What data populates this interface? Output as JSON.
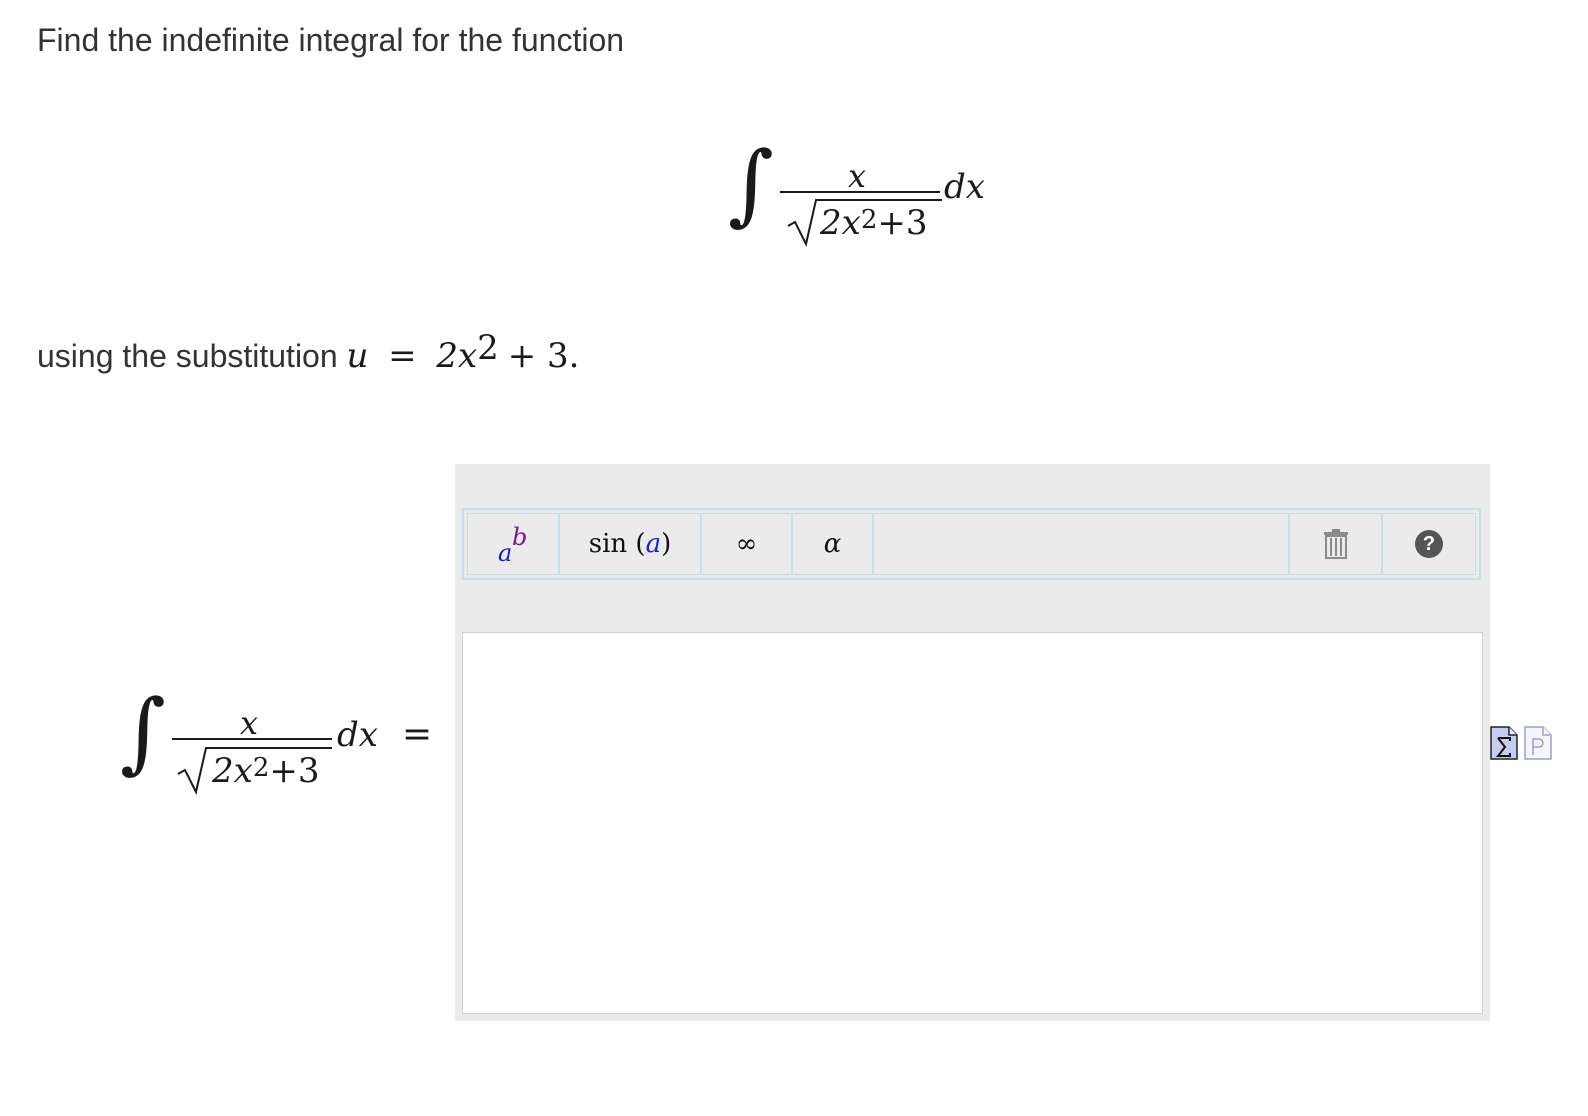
{
  "question": {
    "prompt": "Find the indefinite integral for the function",
    "integrand": {
      "integral_symbol": "∫",
      "numerator": "x",
      "denominator_prefix": "2x",
      "denominator_exponent": "2",
      "denominator_suffix": "+3",
      "differential": "dx"
    },
    "substitution": {
      "text": "using the substitution",
      "variable": "u",
      "equals": "=",
      "expr_prefix": "2x",
      "expr_exponent": "2",
      "expr_suffix": "+ 3."
    },
    "equals_sign": "="
  },
  "editor": {
    "toolbar": {
      "exponent_base": "a",
      "exponent_sup": "b",
      "function_name": "sin",
      "function_open": "(",
      "function_arg": "a",
      "function_close": ")",
      "infinity": "∞",
      "greek": "α",
      "help_glyph": "?"
    },
    "answer_value": ""
  },
  "icons": {
    "exponent_button": "exponent-template-icon",
    "trash": "trash-icon",
    "help": "help-icon",
    "equation_mode": "sigma-equation-icon",
    "plain_mode": "plain-text-page-icon"
  },
  "colors": {
    "toolbar_border": "#c9dfe8",
    "panel_background": "#ebebeb",
    "variable_blue": "#1b1bd6",
    "exponent_purple": "#7a1a8a"
  }
}
